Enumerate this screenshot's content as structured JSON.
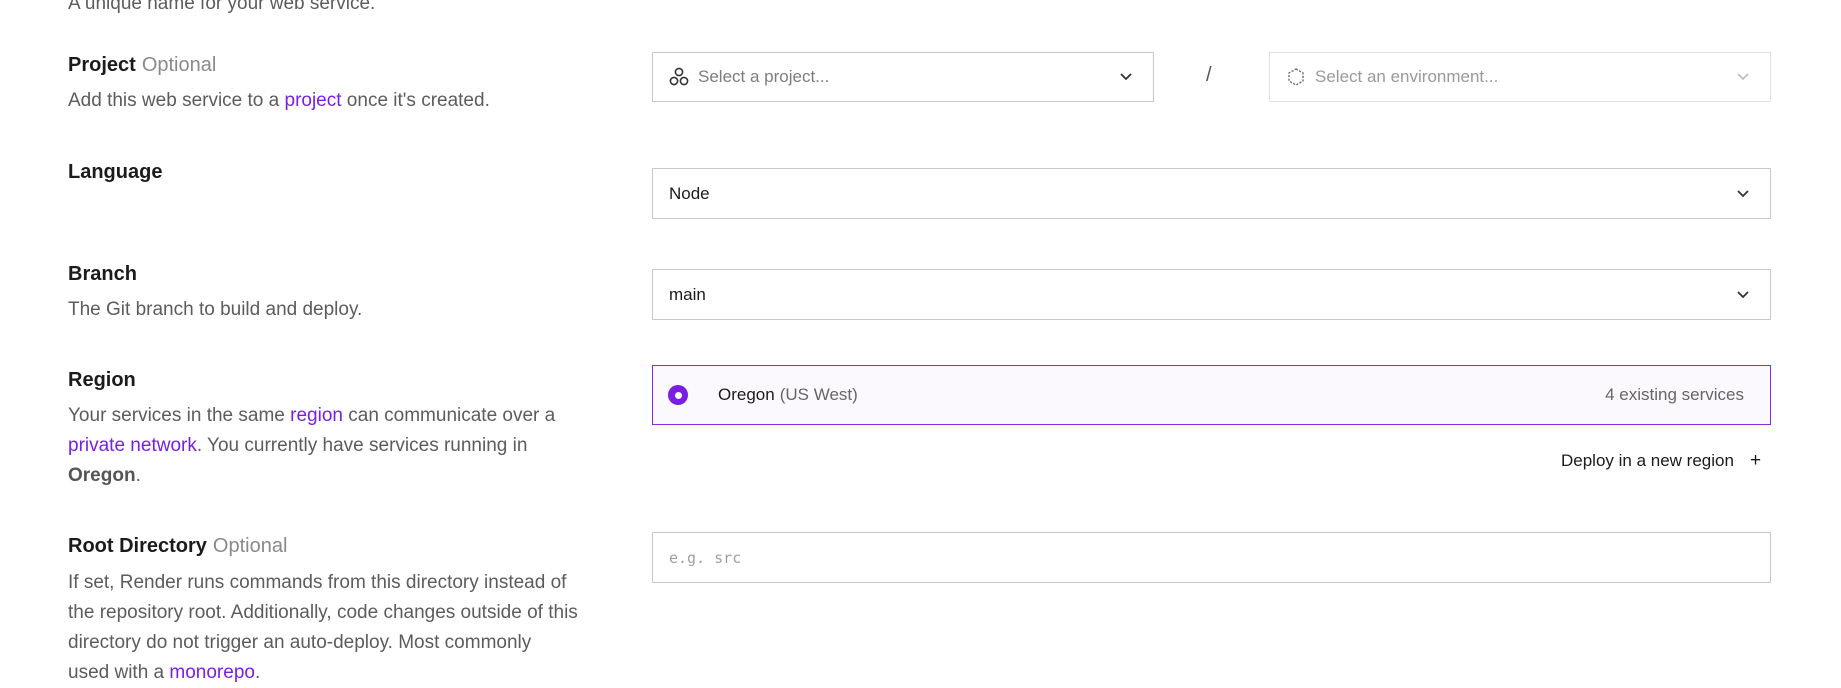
{
  "name_section": {
    "clipped_description": "A unique name for your web service."
  },
  "project": {
    "label": "Project",
    "optional": "Optional",
    "desc_pre": "Add this web service to a ",
    "desc_link": "project",
    "desc_post": " once it's created.",
    "project_placeholder": "Select a project...",
    "separator": "/",
    "environment_placeholder": "Select an environment..."
  },
  "language": {
    "label": "Language",
    "value": "Node"
  },
  "branch": {
    "label": "Branch",
    "description": "The Git branch to build and deploy.",
    "value": "main"
  },
  "region": {
    "label": "Region",
    "desc_pre": "Your services in the same ",
    "desc_link1": "region",
    "desc_mid": " can communicate over a",
    "desc_link2": "private network",
    "desc_mid2": ". You currently have services running in",
    "desc_bold": "Oregon",
    "desc_end": ".",
    "selected_name": "Oregon",
    "selected_sub": "(US West)",
    "existing_services": "4 existing services",
    "new_region_label": "Deploy in a new region",
    "new_region_plus": "+"
  },
  "root_directory": {
    "label": "Root Directory",
    "optional": "Optional",
    "input_placeholder": "e.g. src",
    "line1": "If set, Render runs commands from this directory instead of",
    "line2": "the repository root. Additionally, code changes outside of this",
    "line3": "directory do not trigger an auto-deploy. Most commonly",
    "line4_pre": "used with a ",
    "line4_link": "monorepo",
    "line4_end": "."
  },
  "colors": {
    "accent": "#7a1ee6",
    "selected_bg": "#fbf8fe",
    "border": "#c9c9c9"
  },
  "icons": {
    "project": "project-nodes-icon",
    "environment": "environment-hexagon-icon",
    "dropdown": "chevron-down-icon",
    "radio": "radio-selected-icon",
    "add": "plus-icon"
  }
}
